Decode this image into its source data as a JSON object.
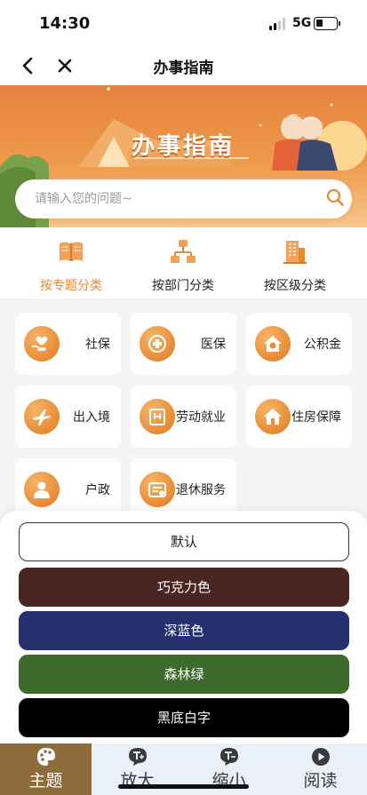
{
  "status_bar": {
    "time": "14:30",
    "network": "5G",
    "battery_level": 0.35
  },
  "nav": {
    "title": "办事指南"
  },
  "banner": {
    "title": "办事指南"
  },
  "search": {
    "placeholder": "请输入您的问题~",
    "value": ""
  },
  "categories": [
    {
      "label": "按专题分类",
      "icon": "book-icon",
      "active": true
    },
    {
      "label": "按部门分类",
      "icon": "org-chart-icon",
      "active": false
    },
    {
      "label": "按区级分类",
      "icon": "building-icon",
      "active": false
    }
  ],
  "services": [
    {
      "label": "社保",
      "icon": "social-security-icon"
    },
    {
      "label": "医保",
      "icon": "medical-insurance-icon"
    },
    {
      "label": "公积金",
      "icon": "housing-fund-icon"
    },
    {
      "label": "出入境",
      "icon": "airplane-icon"
    },
    {
      "label": "劳动就业",
      "icon": "employment-icon"
    },
    {
      "label": "住房保障",
      "icon": "house-icon"
    },
    {
      "label": "户政",
      "icon": "person-icon"
    },
    {
      "label": "退休服务",
      "icon": "retirement-icon"
    }
  ],
  "themes": [
    {
      "label": "默认",
      "background": "#ffffff",
      "text": "#222222",
      "border": "#333333"
    },
    {
      "label": "巧克力色",
      "background": "#4a2623",
      "text": "#ffffff",
      "border": "#4a2623"
    },
    {
      "label": "深蓝色",
      "background": "#25316e",
      "text": "#ffffff",
      "border": "#25316e"
    },
    {
      "label": "森林绿",
      "background": "#3d6b2d",
      "text": "#ffffff",
      "border": "#3d6b2d"
    },
    {
      "label": "黑底白字",
      "background": "#000000",
      "text": "#ffffff",
      "border": "#000000"
    }
  ],
  "tabbar": [
    {
      "label": "主题",
      "icon": "palette-icon",
      "active": true
    },
    {
      "label": "放大",
      "icon": "zoom-in-text-icon",
      "active": false
    },
    {
      "label": "缩小",
      "icon": "zoom-out-text-icon",
      "active": false
    },
    {
      "label": "阅读",
      "icon": "play-icon",
      "active": false
    }
  ],
  "colors": {
    "accent": "#e58a2f",
    "tab_active": "#8d6b3b",
    "tabbar_bg": "#e9f0f7"
  }
}
